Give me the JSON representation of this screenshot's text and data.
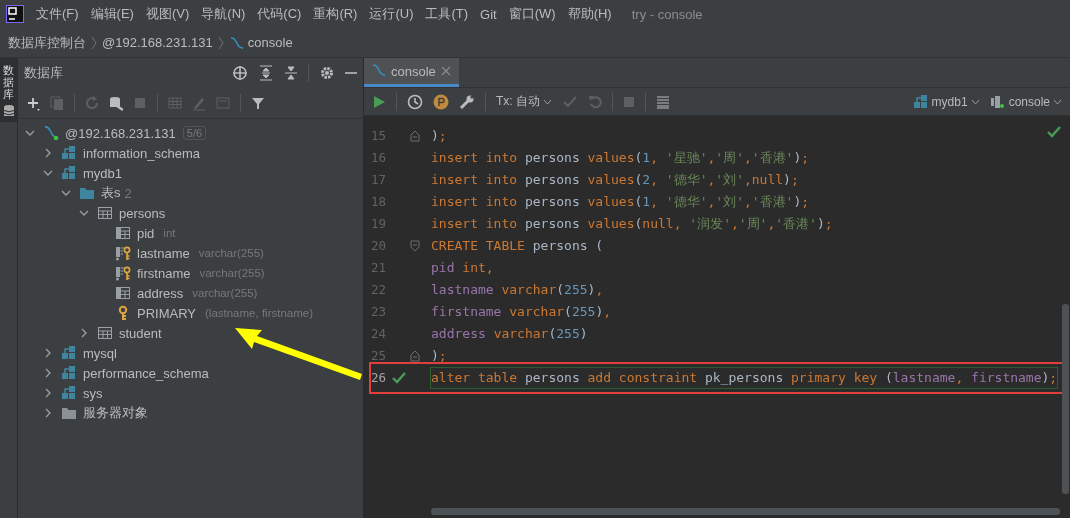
{
  "menu": {
    "items": [
      "文件(F)",
      "编辑(E)",
      "视图(V)",
      "导航(N)",
      "代码(C)",
      "重构(R)",
      "运行(U)",
      "工具(T)",
      "Git",
      "窗口(W)",
      "帮助(H)"
    ],
    "title": "try - console"
  },
  "breadcrumb": [
    "数据库控制台",
    "@192.168.231.131",
    "console"
  ],
  "side_strip": {
    "label": "数据库"
  },
  "db_panel": {
    "title": "数据库",
    "tree": [
      {
        "label": "@192.168.231.131",
        "kind": "connection",
        "detail": "5/6",
        "expanded": true,
        "children": [
          {
            "label": "information_schema",
            "kind": "schema",
            "expanded": false
          },
          {
            "label": "mydb1",
            "kind": "schema",
            "expanded": true,
            "children": [
              {
                "label": "表s",
                "kind": "folder",
                "detail": "2",
                "expanded": true,
                "children": [
                  {
                    "label": "persons",
                    "kind": "table",
                    "expanded": true,
                    "children": [
                      {
                        "label": "pid",
                        "kind": "column",
                        "detail": "int"
                      },
                      {
                        "label": "lastname",
                        "kind": "key_column",
                        "detail": "varchar(255)"
                      },
                      {
                        "label": "firstname",
                        "kind": "key_column",
                        "detail": "varchar(255)"
                      },
                      {
                        "label": "address",
                        "kind": "column",
                        "detail": "varchar(255)"
                      },
                      {
                        "label": "PRIMARY",
                        "kind": "key",
                        "detail": "(lastname, firstname)"
                      }
                    ]
                  },
                  {
                    "label": "student",
                    "kind": "table",
                    "expanded": false
                  }
                ]
              }
            ]
          },
          {
            "label": "mysql",
            "kind": "schema",
            "expanded": false
          },
          {
            "label": "performance_schema",
            "kind": "schema",
            "expanded": false
          },
          {
            "label": "sys",
            "kind": "schema",
            "expanded": false
          },
          {
            "label": "服务器对象",
            "kind": "server_folder",
            "expanded": false
          }
        ]
      }
    ]
  },
  "editor": {
    "tab": {
      "label": "console",
      "selected": true
    },
    "tx_mode": "Tx: 自动",
    "schema": "mydb1",
    "session": "console",
    "lines": [
      {
        "number": "15",
        "fold_end": true,
        "tokens": [
          {
            "kind": "p",
            "text": ")"
          },
          {
            "kind": "op",
            "text": ";"
          }
        ]
      },
      {
        "number": "16",
        "tokens": [
          {
            "kind": "kw",
            "text": "insert into "
          },
          {
            "kind": "id",
            "text": "persons "
          },
          {
            "kind": "kw",
            "text": "values"
          },
          {
            "kind": "p",
            "text": "("
          },
          {
            "kind": "num",
            "text": "1"
          },
          {
            "kind": "op",
            "text": ", "
          },
          {
            "kind": "str",
            "text": "'星驰'"
          },
          {
            "kind": "op",
            "text": ","
          },
          {
            "kind": "str",
            "text": "'周'"
          },
          {
            "kind": "op",
            "text": ","
          },
          {
            "kind": "str",
            "text": "'香港'"
          },
          {
            "kind": "p",
            "text": ")"
          },
          {
            "kind": "op",
            "text": ";"
          }
        ]
      },
      {
        "number": "17",
        "tokens": [
          {
            "kind": "kw",
            "text": "insert into "
          },
          {
            "kind": "id",
            "text": "persons "
          },
          {
            "kind": "kw",
            "text": "values"
          },
          {
            "kind": "p",
            "text": "("
          },
          {
            "kind": "num",
            "text": "2"
          },
          {
            "kind": "op",
            "text": ", "
          },
          {
            "kind": "str",
            "text": "'德华'"
          },
          {
            "kind": "op",
            "text": ","
          },
          {
            "kind": "str",
            "text": "'刘'"
          },
          {
            "kind": "op",
            "text": ","
          },
          {
            "kind": "kw",
            "text": "null"
          },
          {
            "kind": "p",
            "text": ")"
          },
          {
            "kind": "op",
            "text": ";"
          }
        ]
      },
      {
        "number": "18",
        "tokens": [
          {
            "kind": "kw",
            "text": "insert into "
          },
          {
            "kind": "id",
            "text": "persons "
          },
          {
            "kind": "kw",
            "text": "values"
          },
          {
            "kind": "p",
            "text": "("
          },
          {
            "kind": "num",
            "text": "1"
          },
          {
            "kind": "op",
            "text": ", "
          },
          {
            "kind": "str",
            "text": "'德华'"
          },
          {
            "kind": "op",
            "text": ","
          },
          {
            "kind": "str",
            "text": "'刘'"
          },
          {
            "kind": "op",
            "text": ","
          },
          {
            "kind": "str",
            "text": "'香港'"
          },
          {
            "kind": "p",
            "text": ")"
          },
          {
            "kind": "op",
            "text": ";"
          }
        ]
      },
      {
        "number": "19",
        "tokens": [
          {
            "kind": "kw",
            "text": "insert into "
          },
          {
            "kind": "id",
            "text": "persons "
          },
          {
            "kind": "kw",
            "text": "values"
          },
          {
            "kind": "p",
            "text": "("
          },
          {
            "kind": "kw",
            "text": "null"
          },
          {
            "kind": "op",
            "text": ", "
          },
          {
            "kind": "str",
            "text": "'润发'"
          },
          {
            "kind": "op",
            "text": ","
          },
          {
            "kind": "str",
            "text": "'周'"
          },
          {
            "kind": "op",
            "text": ","
          },
          {
            "kind": "str",
            "text": "'香港'"
          },
          {
            "kind": "p",
            "text": ")"
          },
          {
            "kind": "op",
            "text": ";"
          }
        ]
      },
      {
        "number": "20",
        "fold_start": true,
        "tokens": [
          {
            "kind": "kw",
            "text": "CREATE TABLE "
          },
          {
            "kind": "id",
            "text": "persons ("
          }
        ]
      },
      {
        "number": "21",
        "tokens": [
          {
            "kind": "col",
            "text": "pid "
          },
          {
            "kind": "kw",
            "text": "int"
          },
          {
            "kind": "op",
            "text": ","
          }
        ]
      },
      {
        "number": "22",
        "tokens": [
          {
            "kind": "col",
            "text": "lastname "
          },
          {
            "kind": "kw",
            "text": "varchar"
          },
          {
            "kind": "p",
            "text": "("
          },
          {
            "kind": "num",
            "text": "255"
          },
          {
            "kind": "p",
            "text": ")"
          },
          {
            "kind": "op",
            "text": ","
          }
        ]
      },
      {
        "number": "23",
        "tokens": [
          {
            "kind": "col",
            "text": "firstname "
          },
          {
            "kind": "kw",
            "text": "varchar"
          },
          {
            "kind": "p",
            "text": "("
          },
          {
            "kind": "num",
            "text": "255"
          },
          {
            "kind": "p",
            "text": ")"
          },
          {
            "kind": "op",
            "text": ","
          }
        ]
      },
      {
        "number": "24",
        "tokens": [
          {
            "kind": "col",
            "text": "address "
          },
          {
            "kind": "kw",
            "text": "varchar"
          },
          {
            "kind": "p",
            "text": "("
          },
          {
            "kind": "num",
            "text": "255"
          },
          {
            "kind": "p",
            "text": ")"
          }
        ]
      },
      {
        "number": "25",
        "fold_end": true,
        "tokens": [
          {
            "kind": "p",
            "text": ")"
          },
          {
            "kind": "op",
            "text": ";"
          }
        ]
      },
      {
        "number": "26",
        "passed": true,
        "highlighted": true,
        "tokens": [
          {
            "kind": "kw",
            "text": "alter table "
          },
          {
            "kind": "id",
            "text": "persons "
          },
          {
            "kind": "kw",
            "text": "add constraint "
          },
          {
            "kind": "id",
            "text": "pk_persons "
          },
          {
            "kind": "kw",
            "text": "primary key "
          },
          {
            "kind": "p",
            "text": "("
          },
          {
            "kind": "col",
            "text": "lastname"
          },
          {
            "kind": "op",
            "text": ", "
          },
          {
            "kind": "col",
            "text": "firstname"
          },
          {
            "kind": "p",
            "text": ")"
          },
          {
            "kind": "op",
            "text": ";"
          }
        ]
      }
    ]
  }
}
